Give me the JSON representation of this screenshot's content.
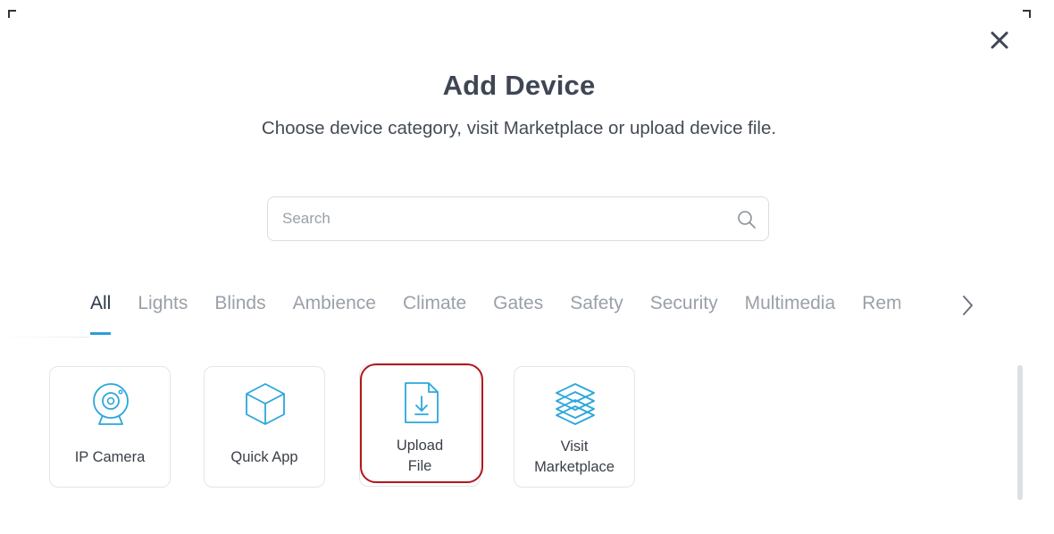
{
  "dialog": {
    "title": "Add Device",
    "subtitle": "Choose device category, visit Marketplace or upload device file."
  },
  "search": {
    "placeholder": "Search",
    "value": ""
  },
  "tabs": [
    {
      "label": "All",
      "active": true
    },
    {
      "label": "Lights",
      "active": false
    },
    {
      "label": "Blinds",
      "active": false
    },
    {
      "label": "Ambience",
      "active": false
    },
    {
      "label": "Climate",
      "active": false
    },
    {
      "label": "Gates",
      "active": false
    },
    {
      "label": "Safety",
      "active": false
    },
    {
      "label": "Security",
      "active": false
    },
    {
      "label": "Multimedia",
      "active": false
    },
    {
      "label": "Rem",
      "active": false
    }
  ],
  "cards": [
    {
      "label_lines": [
        "IP Camera"
      ],
      "icon": "ip-camera-icon"
    },
    {
      "label_lines": [
        "Quick App"
      ],
      "icon": "cube-icon"
    },
    {
      "label_lines": [
        "Upload",
        "File"
      ],
      "icon": "file-download-icon"
    },
    {
      "label_lines": [
        "Visit",
        "Marketplace"
      ],
      "icon": "layers-icon"
    }
  ],
  "colors": {
    "accent": "#2b9ed8",
    "icon": "#2aa7dc",
    "highlight": "#b3161c",
    "title": "#3f4653"
  },
  "icons": {
    "close": "close-icon",
    "search": "search-icon",
    "tabs_next": "chevron-right-icon"
  }
}
